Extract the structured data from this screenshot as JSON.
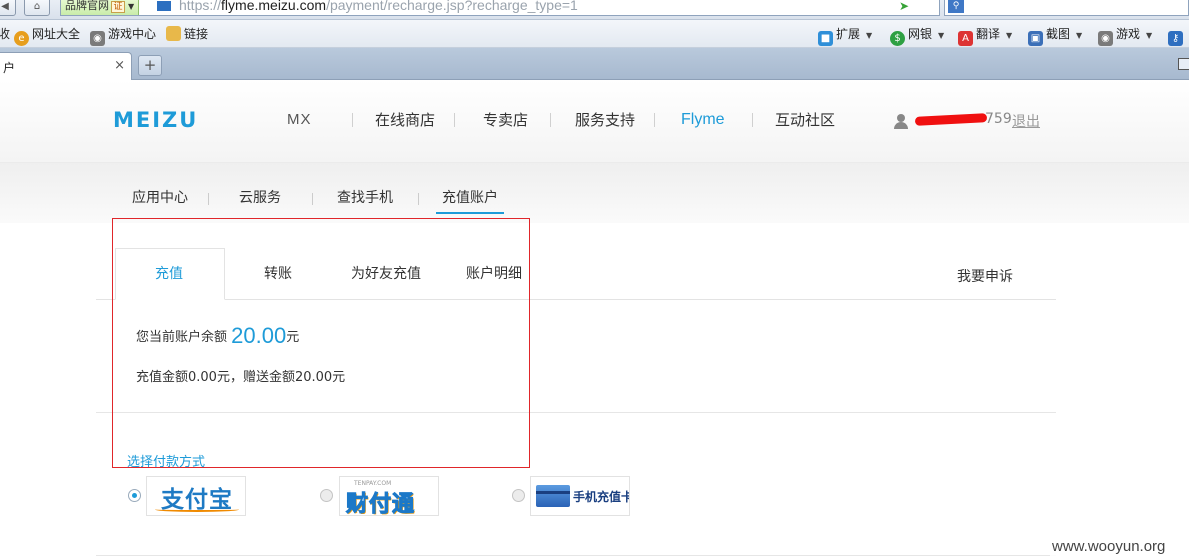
{
  "browser": {
    "site_badge": "品牌官网",
    "cert_label": "证",
    "url_prefix": "https://",
    "url_domain": "flyme.meizu.com",
    "url_path": "/payment/recharge.jsp?recharge_type=1",
    "bookmarks": [
      {
        "label": "网址大全",
        "icon": "globe-icon",
        "color": "#e79e1d"
      },
      {
        "label": "游戏中心",
        "icon": "gamepad-icon",
        "color": "#6b6b6b"
      },
      {
        "label": "链接",
        "icon": "folder-icon",
        "color": "#e8b84a"
      }
    ],
    "fav_left_stub": "收",
    "toolbar_items": [
      {
        "label": "扩展",
        "icon": "extension-icon",
        "color": "#2f8fd8"
      },
      {
        "label": "网银",
        "icon": "shield-icon",
        "color": "#2ea043"
      },
      {
        "label": "翻译",
        "icon": "translate-icon",
        "color": "#d33"
      },
      {
        "label": "截图",
        "icon": "screenshot-icon",
        "color": "#3b6fb8"
      },
      {
        "label": "游戏",
        "icon": "gamepad-icon",
        "color": "#6b6b6b"
      }
    ],
    "tab_title": "户",
    "tab_close": "×",
    "tab_new": "+"
  },
  "header": {
    "logo": "MEIZU",
    "nav": [
      "MX",
      "在线商店",
      "专卖店",
      "服务支持",
      "Flyme",
      "互动社区"
    ],
    "active_nav": "Flyme",
    "user_suffix": "759",
    "logout": "退出"
  },
  "subnav": {
    "items": [
      "应用中心",
      "云服务",
      "查找手机",
      "充值账户"
    ],
    "active": "充值账户"
  },
  "recharge": {
    "tabs": [
      "充值",
      "转账",
      "为好友充值",
      "账户明细"
    ],
    "active_tab": "充值",
    "complain": "我要申诉",
    "balance_label": "您当前账户余额",
    "balance_amount": "20.00",
    "balance_unit": "元",
    "detail": "充值金额0.00元，赠送金额20.00元",
    "pay_title": "选择付款方式",
    "methods": [
      {
        "name": "支付宝",
        "selected": true
      },
      {
        "name": "财付通",
        "sub": "TENPAY.COM",
        "selected": false
      },
      {
        "name": "手机充值卡",
        "selected": false
      }
    ]
  },
  "watermark": "www.wooyun.org",
  "colors": {
    "accent": "#1e9bd8",
    "annotation": "#e0262a"
  }
}
